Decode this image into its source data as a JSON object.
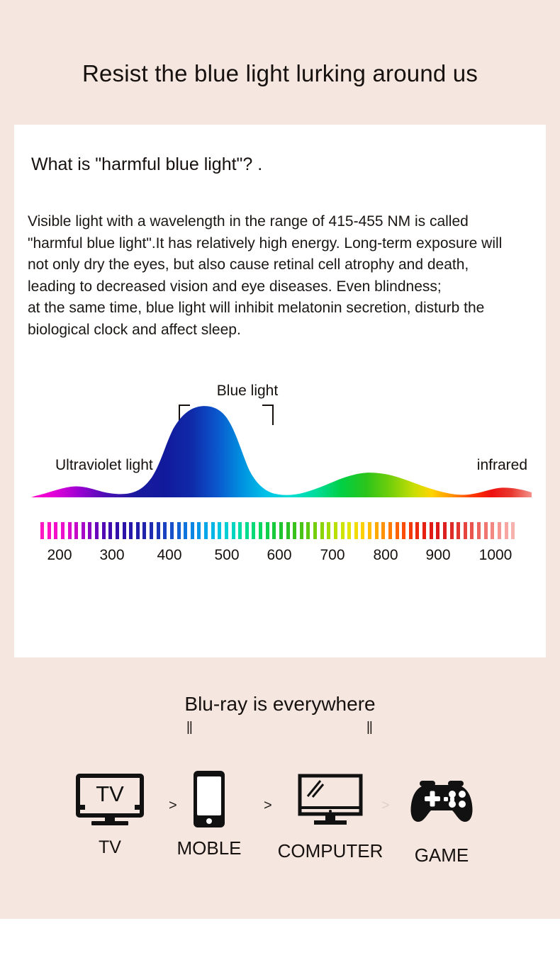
{
  "hero": {
    "title": "Resist the blue light lurking around us"
  },
  "card": {
    "heading": "What is \"harmful blue light\"? .",
    "paragraph_lines": [
      "Visible light with a wavelength in the range of 415-455 NM is called",
      "\"harmful blue light\".It has relatively high energy. Long-term exposure will",
      "not only dry the eyes, but also cause retinal cell atrophy and death,",
      "leading to decreased vision and eye diseases. Even blindness;",
      "at the same time, blue light will inhibit melatonin secretion, disturb the",
      "biological clock and affect sleep."
    ]
  },
  "chart_data": {
    "type": "area",
    "title": "",
    "xlabel": "",
    "ylabel": "",
    "xlim": [
      150,
      1050
    ],
    "ylim": [
      0,
      1
    ],
    "grid": false,
    "tick_labels": [
      "200",
      "300",
      "400",
      "500",
      "600",
      "700",
      "800",
      "900",
      "1000"
    ],
    "tick_values": [
      200,
      300,
      400,
      500,
      600,
      700,
      800,
      900,
      1000
    ],
    "annotations": [
      {
        "text": "Blue light",
        "range_nm": [
          415,
          500
        ]
      },
      {
        "text": "Ultraviolet light",
        "range_nm": [
          200,
          380
        ]
      },
      {
        "text": "infrared",
        "range_nm": [
          780,
          1000
        ]
      }
    ],
    "x": [
      180,
      220,
      260,
      300,
      340,
      380,
      400,
      420,
      440,
      460,
      480,
      500,
      520,
      560,
      600,
      640,
      680,
      700,
      740,
      780,
      820,
      860,
      900,
      940,
      980,
      1020
    ],
    "values": [
      0.02,
      0.07,
      0.06,
      0.04,
      0.05,
      0.1,
      0.2,
      0.45,
      0.72,
      0.9,
      0.97,
      0.95,
      0.85,
      0.5,
      0.2,
      0.05,
      0.03,
      0.07,
      0.18,
      0.3,
      0.34,
      0.3,
      0.2,
      0.08,
      0.05,
      0.09
    ],
    "spectrum_colors": [
      "#ff00b2",
      "#cc00cc",
      "#7a00c4",
      "#3a1fae",
      "#1f32b4",
      "#0a66d0",
      "#00a8e0",
      "#00e0d0",
      "#00d46a",
      "#44cc22",
      "#9ad800",
      "#ffe600",
      "#ffa800",
      "#ff5500",
      "#ee1111",
      "#e03030",
      "#f08080",
      "#f6a5a5"
    ]
  },
  "section2": {
    "title": "Blu-ray is everywhere",
    "tick_left": "||",
    "tick_right": "||"
  },
  "devices": {
    "arrows": [
      ">",
      ">",
      ">"
    ],
    "items": [
      {
        "label": "TV",
        "icon": "tv-icon",
        "screen_text": "TV"
      },
      {
        "label": "MOBLE",
        "icon": "mobile-icon",
        "screen_text": ""
      },
      {
        "label": "COMPUTER",
        "icon": "monitor-icon",
        "screen_text": ""
      },
      {
        "label": "GAME",
        "icon": "gamepad-icon",
        "screen_text": ""
      }
    ]
  },
  "colors": {
    "background": "#f5e7df",
    "card": "#ffffff",
    "text": "#16110f"
  }
}
